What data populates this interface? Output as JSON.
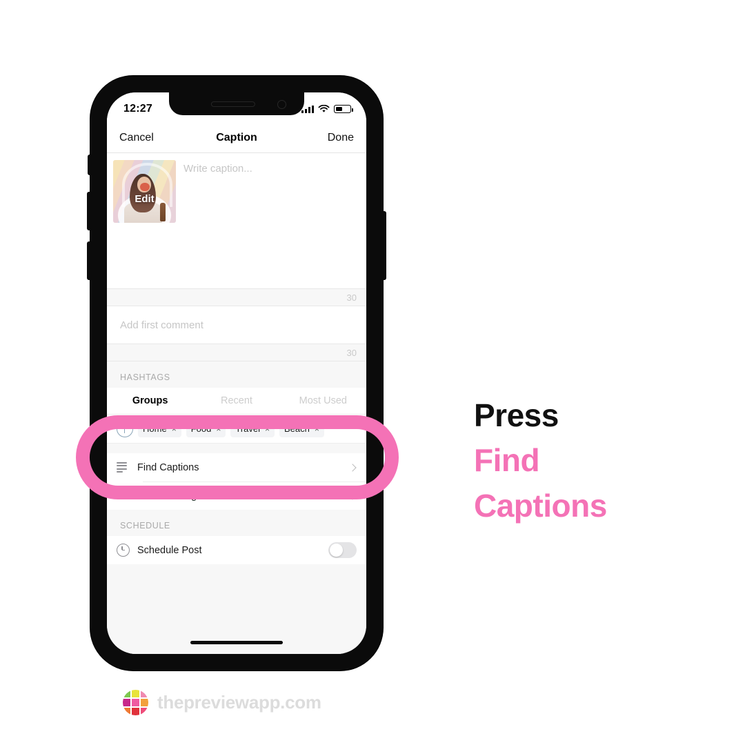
{
  "phone": {
    "status_bar": {
      "time": "12:27",
      "signal_icon": "cellular-bars-icon",
      "wifi_icon": "wifi-icon",
      "battery_icon": "battery-icon"
    },
    "nav_bar": {
      "cancel_label": "Cancel",
      "title": "Caption",
      "done_label": "Done"
    },
    "caption": {
      "placeholder": "Write caption...",
      "thumbnail_edit_label": "Edit",
      "counter": "30"
    },
    "comment": {
      "placeholder": "Add first comment",
      "counter": "30"
    },
    "hashtags": {
      "section_label": "HASHTAGS",
      "tabs": [
        {
          "label": "Groups",
          "active": true
        },
        {
          "label": "Recent",
          "active": false
        },
        {
          "label": "Most Used",
          "active": false
        }
      ],
      "add_icon": "plus-circle-icon",
      "chips": [
        {
          "label": "Home",
          "remove": "×"
        },
        {
          "label": "Food",
          "remove": "×"
        },
        {
          "label": "Travel",
          "remove": "×"
        },
        {
          "label": "Beach",
          "remove": "×"
        }
      ]
    },
    "actions": [
      {
        "label": "Find Captions",
        "icon": "lines-icon"
      },
      {
        "label": "Find Hashtags",
        "icon": "hash-icon"
      }
    ],
    "schedule": {
      "section_label": "SCHEDULE",
      "row_label": "Schedule Post",
      "icon": "clock-icon",
      "toggle_on": false
    }
  },
  "callout": {
    "line1": "Press",
    "line2": "Find",
    "line3": "Captions"
  },
  "footer": {
    "brand": "thepreviewapp.com"
  },
  "colors": {
    "accent_pink": "#f472b6",
    "text_black": "#111111",
    "footer_gray": "#dcdcdc"
  },
  "logo_cells": [
    "#7ec850",
    "#e8e33a",
    "#f08ab0",
    "#c7288a",
    "#ef5ba1",
    "#f2a03c",
    "#ef7a35",
    "#e0323c",
    "#ef4e7b"
  ]
}
